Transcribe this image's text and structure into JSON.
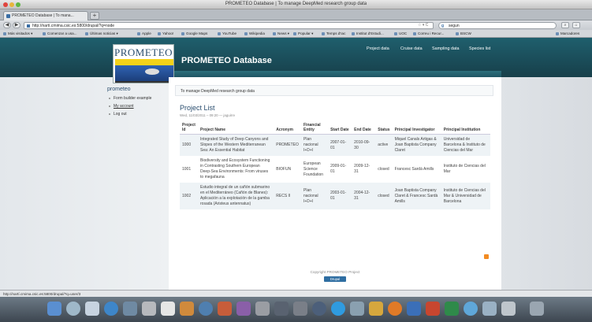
{
  "browser": {
    "window_title": "PROMETEO Database | To manage DeepMed research group data",
    "tab_title": "PROMETEO Database | To mana...",
    "new_tab": "+",
    "url": "http://nartí.cmima.csic.es:5800/drupal/?q=node",
    "search_engine": "g",
    "search_value": "segun",
    "bookmarks": [
      "Más visitados ▾",
      "Comenzar a usa...",
      "Últimas noticias ▾",
      "Apple",
      "Yahoo!",
      "Google Maps",
      "YouTube",
      "Wikipedia",
      "News ▾",
      "Popular ▾",
      "Temps d'Iac",
      "Institut d'Estudi...",
      "UOC",
      "Correu i Recur...",
      "BSCW",
      "Marcadores"
    ],
    "status_url": "http://nartí.cmima.csic.es:5800/drupal/?q=user/3"
  },
  "site": {
    "logo_text": "PROMETEO",
    "name": "PROMETEO Database",
    "primary_links": [
      "Project data",
      "Cruise data",
      "Sampling data",
      "Species list"
    ]
  },
  "sidebar": {
    "title": "prometeo",
    "items": [
      {
        "label": "Form builder example",
        "active": false
      },
      {
        "label": "My account",
        "active": true
      },
      {
        "label": "Log out",
        "active": false
      }
    ]
  },
  "content": {
    "mission": "To manage DeepMed research group data",
    "title": "Project List",
    "submitted": "Wed, 11/03/2011 – 09:20 — jaguirre",
    "table": {
      "headers": [
        "Project Id",
        "Project Name",
        "Acronym",
        "Financial Entity",
        "Start Date",
        "End Date",
        "Status",
        "Principal Investigator",
        "Principal Institution"
      ],
      "rows": [
        [
          "1000",
          "Integrated Study of Deep Canyons and Slopes of the Western Mediterranean Sea: An Essential Habitat",
          "PROMETEO",
          "Plan nacional I+D+I",
          "2007-01-01",
          "2010-09-30",
          "active",
          "Miquel Canals Artigas & Joan Baptista Company Claret",
          "Universidad de Barcelona & Instituto de Ciencias del Mar"
        ],
        [
          "1001",
          "Biodiversity and Ecosystem Functioning in Contrasting Southern European Deep-Sea Environments: From viruses to megafauna",
          "BIOFUN",
          "European Science Foundation",
          "2009-01-01",
          "2009-12-31",
          "closed",
          "Francesc Sardà Amills",
          "Instituto de Ciencias del Mar"
        ],
        [
          "1002",
          "Estudio integral de un cañón submarino en el Mediterráneo (Cañón de Blanes): Aplicación a la explotación de la gamba rosada (Aristeus antennatus)",
          "RECS II",
          "Plan nacional I+D+I",
          "2003-01-01",
          "2004-12-31",
          "closed",
          "Joan Baptista Company Claret & Francesc Sardà Amills",
          "Instituto de Ciencias del Mar & Universidad de Barcelona"
        ]
      ]
    },
    "copyright": "Copyright PROMETEO Project",
    "drupal_badge": "Drupal"
  },
  "colors": {
    "header": "#1f5f6d",
    "title": "#2a4d6e",
    "row_alt": "#eef3f6"
  }
}
